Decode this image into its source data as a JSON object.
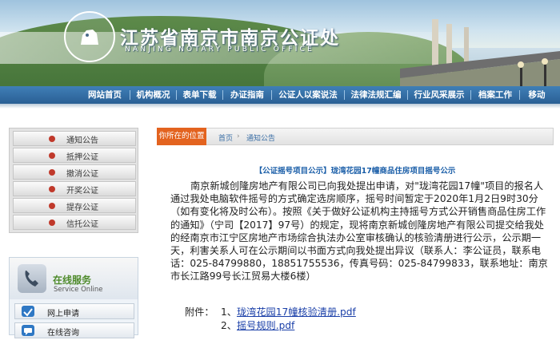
{
  "header": {
    "title": "江苏省南京市南京公证处",
    "subtitle": "NANJING NOTARY PUBLIC OFFICE",
    "seal_icon": "lion-seal-icon"
  },
  "nav": {
    "items": [
      "网站首页",
      "机构概况",
      "表单下载",
      "办证指南",
      "公证人以案说法",
      "法律法规汇编",
      "行业风采展示",
      "档案工作",
      "移动"
    ]
  },
  "sidebar": {
    "menu": [
      "通知公告",
      "抵押公证",
      "撤消公证",
      "开奖公证",
      "提存公证",
      "信托公证"
    ],
    "online": {
      "title": "在线服务",
      "subtitle": "Service Online",
      "items": [
        "网上申请",
        "在线咨询"
      ]
    }
  },
  "breadcrumb": {
    "label": "你所在的位置",
    "home": "首页",
    "separator": "›",
    "current": "通知公告"
  },
  "article": {
    "title": "【公证摇号项目公示】珑湾花园17幢商品住房项目摇号公示",
    "body": "南京新城创隆房地产有限公司已向我处提出申请，对\"珑湾花园17幢\"项目的报名人通过我处电脑软件摇号的方式确定选房顺序，摇号时间暂定于2020年1月2日9时30分（如有变化将及时公布）。按照《关于做好公证机构主持摇号方式公开销售商品住房工作的通知》（宁司【2017】97号）的规定，现将南京新城创隆房地产有限公司提交给我处的经南京市江宁区房地产市场综合执法办公室审核确认的核验清册进行公示，公示期一天，利害关系人可在公示期间以书面方式向我处提出异议（联系人：李公证员，联系电话：025-84799880，18851755536，传真号码：025-84799833，联系地址：南京市长江路99号长江贸易大楼6楼）",
    "attachments_label": "附件：",
    "attachments": [
      {
        "index": "1、",
        "name": "珑湾花园17幢核验清册.pdf"
      },
      {
        "index": "2、",
        "name": "摇号规则.pdf"
      }
    ]
  },
  "colors": {
    "nav_bg": "#2a5f94",
    "crumb_accent": "#e3631f",
    "title_blue": "#1a5ea8",
    "link_blue": "#1a3fa8"
  }
}
